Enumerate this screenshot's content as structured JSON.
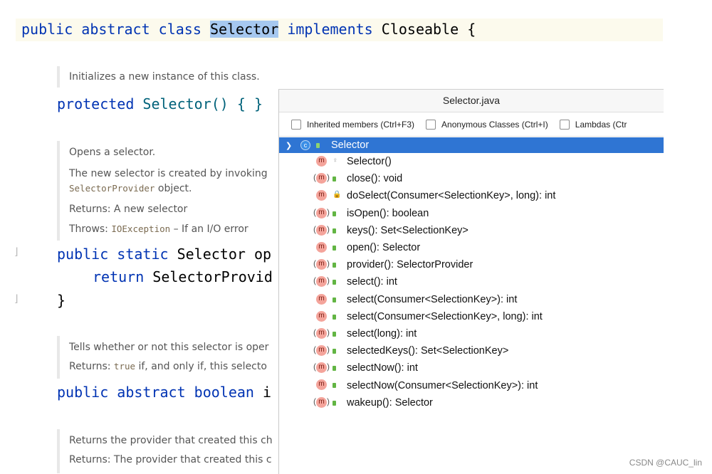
{
  "code": {
    "class_decl": {
      "kw1": "public",
      "kw2": "abstract",
      "kw3": "class",
      "name": "Selector",
      "kw4": "implements",
      "iface": "Closeable",
      "brace": "{"
    },
    "ctor": {
      "kw": "protected",
      "sig": "Selector() { }"
    },
    "open_method": {
      "kw1": "public",
      "kw2": "static",
      "text": "Selector op"
    },
    "return_line": {
      "kw": "return",
      "text": "SelectorProvid"
    },
    "close_brace": "}",
    "isopen_method": {
      "kw1": "public",
      "kw2": "abstract",
      "kw3": "boolean",
      "text": "i"
    }
  },
  "docs": {
    "d1": "Initializes a new instance of this class.",
    "d2_l1": "Opens a selector.",
    "d2_l2": "The new selector is created by invoking",
    "d2_l3a": "SelectorProvider",
    "d2_l3b": " object.",
    "d2_l4": "Returns: A new selector",
    "d2_l5a": "Throws: ",
    "d2_l5b": "IOException",
    "d2_l5c": " – If an I/O error",
    "d3_l1": "Tells whether or not this selector is oper",
    "d3_l2a": "Returns: ",
    "d3_l2b": "true",
    "d3_l2c": " if, and only if, this selecto",
    "d4_l1": "Returns the provider that created this ch",
    "d4_l2": "Returns: The provider that created this c"
  },
  "popup": {
    "title": "Selector.java",
    "options": [
      {
        "label": "Inherited members (Ctrl+F3)"
      },
      {
        "label": "Anonymous Classes (Ctrl+I)"
      },
      {
        "label": "Lambdas (Ctr"
      }
    ],
    "root": {
      "label": "Selector",
      "icon": "class-icon"
    },
    "members": [
      {
        "label": "Selector()",
        "vis": "package"
      },
      {
        "label": "close(): void",
        "vis": "public",
        "abstract": true
      },
      {
        "label": "doSelect(Consumer<SelectionKey>, long): int",
        "vis": "private"
      },
      {
        "label": "isOpen(): boolean",
        "vis": "public",
        "abstract": true
      },
      {
        "label": "keys(): Set<SelectionKey>",
        "vis": "public",
        "abstract": true
      },
      {
        "label": "open(): Selector",
        "vis": "public"
      },
      {
        "label": "provider(): SelectorProvider",
        "vis": "public",
        "abstract": true
      },
      {
        "label": "select(): int",
        "vis": "public",
        "abstract": true
      },
      {
        "label": "select(Consumer<SelectionKey>): int",
        "vis": "public"
      },
      {
        "label": "select(Consumer<SelectionKey>, long): int",
        "vis": "public"
      },
      {
        "label": "select(long): int",
        "vis": "public",
        "abstract": true
      },
      {
        "label": "selectedKeys(): Set<SelectionKey>",
        "vis": "public",
        "abstract": true
      },
      {
        "label": "selectNow(): int",
        "vis": "public",
        "abstract": true
      },
      {
        "label": "selectNow(Consumer<SelectionKey>): int",
        "vis": "public"
      },
      {
        "label": "wakeup(): Selector",
        "vis": "public",
        "abstract": true
      }
    ],
    "method_icon_letter": "m"
  },
  "watermark": "CSDN @CAUC_lin"
}
